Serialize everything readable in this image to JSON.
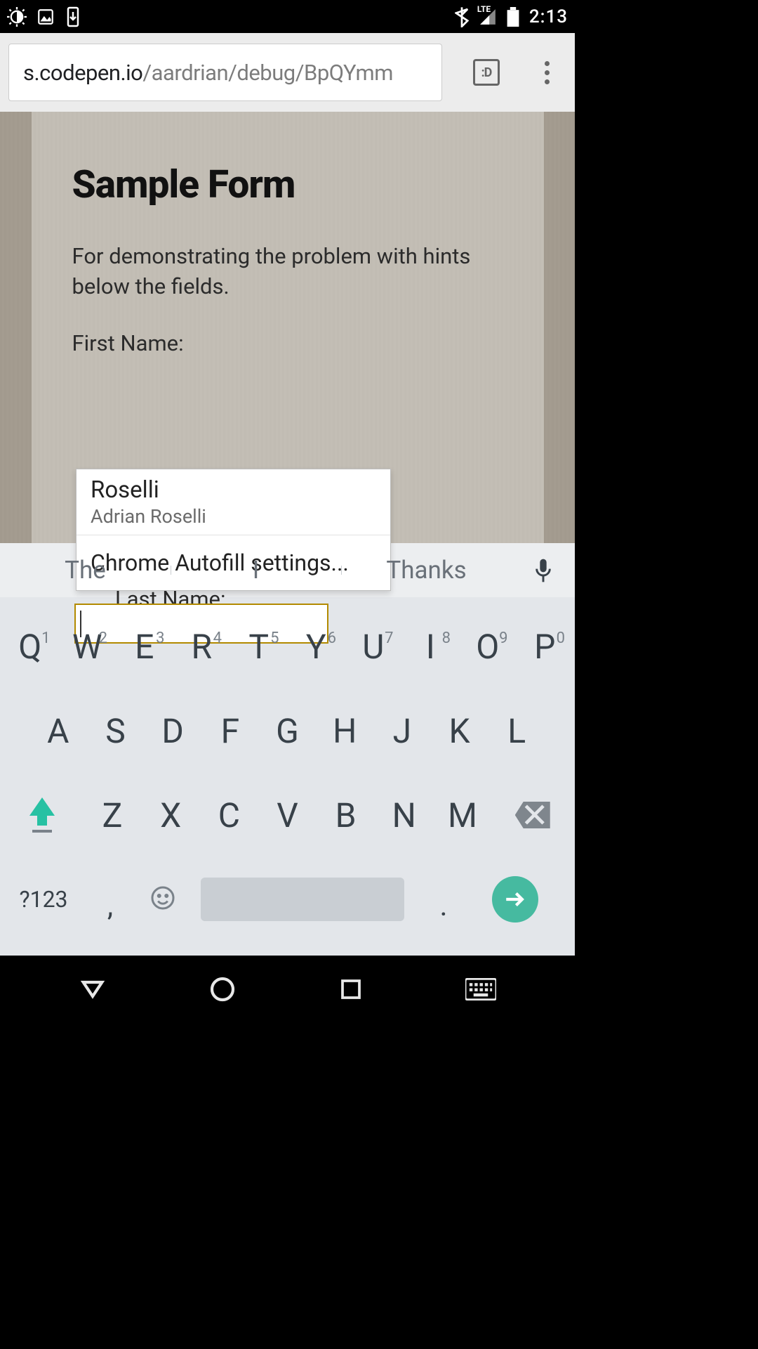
{
  "status": {
    "lte": "LTE",
    "clock": "2:13"
  },
  "chrome": {
    "url_host": "s.codepen.io",
    "url_path": "/aardrian/debug/BpQYmm",
    "tab_label": ":D"
  },
  "page": {
    "title": "Sample Form",
    "intro": "For demonstrating the problem with hints below the fields.",
    "first_name_label": "First Name:",
    "last_name_label": "Last Name:",
    "last_name_value": ""
  },
  "autofill": {
    "primary": "Roselli",
    "secondary": "Adrian Roselli",
    "settings": "Chrome Autofill settings..."
  },
  "suggestions": [
    "The",
    "I",
    "Thanks"
  ],
  "keyboard": {
    "row1": [
      "Q",
      "W",
      "E",
      "R",
      "T",
      "Y",
      "U",
      "I",
      "O",
      "P"
    ],
    "nums": [
      "1",
      "2",
      "3",
      "4",
      "5",
      "6",
      "7",
      "8",
      "9",
      "0"
    ],
    "row2": [
      "A",
      "S",
      "D",
      "F",
      "G",
      "H",
      "J",
      "K",
      "L"
    ],
    "row3": [
      "Z",
      "X",
      "C",
      "V",
      "B",
      "N",
      "M"
    ],
    "sym": "?123",
    "comma": ",",
    "dot": "."
  }
}
